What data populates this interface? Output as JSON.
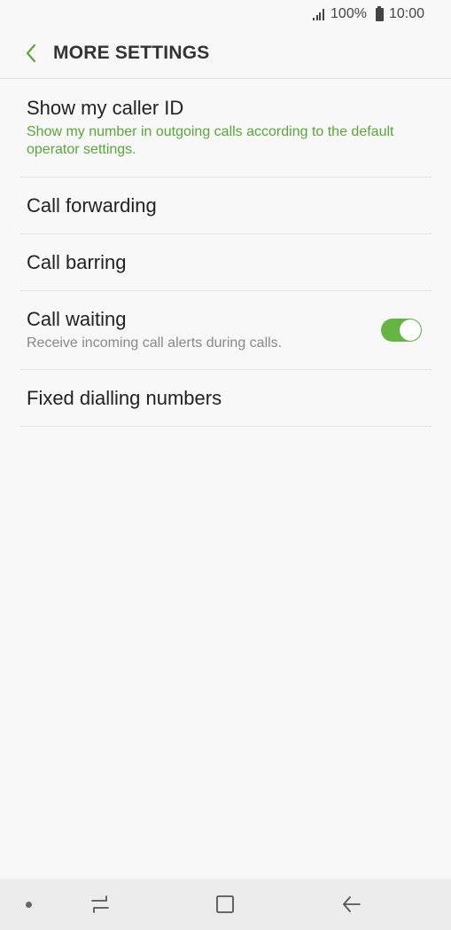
{
  "status_bar": {
    "battery": "100%",
    "time": "10:00"
  },
  "header": {
    "title": "MORE SETTINGS"
  },
  "items": [
    {
      "title": "Show my caller ID",
      "subtitle": "Show my number in outgoing calls according to the default operator settings."
    },
    {
      "title": "Call forwarding"
    },
    {
      "title": "Call barring"
    },
    {
      "title": "Call waiting",
      "subtitle": "Receive incoming call alerts during calls.",
      "toggle_on": true
    },
    {
      "title": "Fixed dialling numbers"
    }
  ],
  "colors": {
    "accent": "#5aa63a",
    "toggle_on": "#66b544"
  },
  "icons": {
    "back": "chevron-left-icon",
    "nav_recents": "recents-icon",
    "nav_home": "home-icon",
    "nav_back": "back-arrow-icon"
  }
}
